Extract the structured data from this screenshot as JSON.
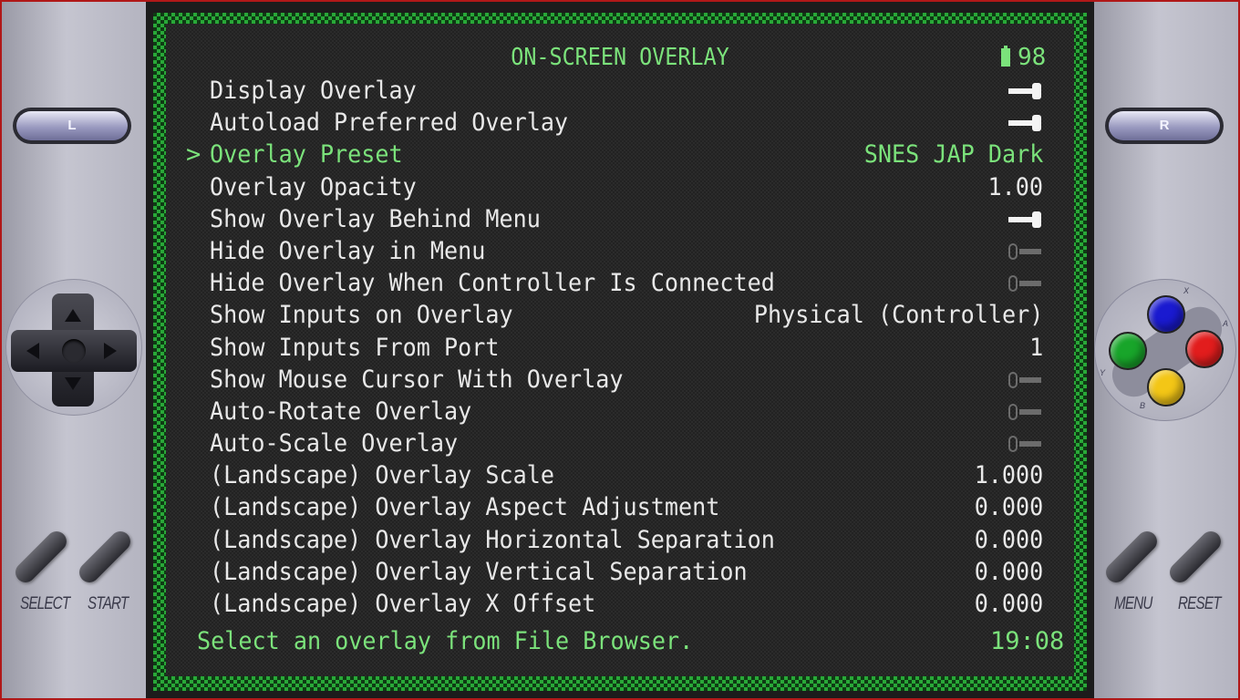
{
  "colors": {
    "accent": "#7be27b",
    "border_outer": "#b01818",
    "checker": "#29a838"
  },
  "controller": {
    "l_label": "L",
    "r_label": "R",
    "select_label": "SELECT",
    "start_label": "START",
    "menu_label": "MENU",
    "reset_label": "RESET",
    "face": {
      "x": "X",
      "a": "A",
      "y": "Y",
      "b": "B"
    }
  },
  "header": {
    "title": "ON-SCREEN OVERLAY",
    "battery": "98"
  },
  "menu": {
    "items": [
      {
        "label": "Display Overlay",
        "type": "toggle",
        "state": "on"
      },
      {
        "label": "Autoload Preferred Overlay",
        "type": "toggle",
        "state": "on"
      },
      {
        "label": "Overlay Preset",
        "value": "SNES JAP Dark",
        "selected": true
      },
      {
        "label": "Overlay Opacity",
        "value": "1.00"
      },
      {
        "label": "Show Overlay Behind Menu",
        "type": "toggle",
        "state": "on"
      },
      {
        "label": "Hide Overlay in Menu",
        "type": "toggle",
        "state": "off"
      },
      {
        "label": "Hide Overlay When Controller Is Connected",
        "type": "toggle",
        "state": "off"
      },
      {
        "label": "Show Inputs on Overlay",
        "value": "Physical (Controller)"
      },
      {
        "label": "Show Inputs From Port",
        "value": "1"
      },
      {
        "label": "Show Mouse Cursor With Overlay",
        "type": "toggle",
        "state": "off"
      },
      {
        "label": "Auto-Rotate Overlay",
        "type": "toggle",
        "state": "off"
      },
      {
        "label": "Auto-Scale Overlay",
        "type": "toggle",
        "state": "off"
      },
      {
        "label": "(Landscape) Overlay Scale",
        "value": "1.000"
      },
      {
        "label": "(Landscape) Overlay Aspect Adjustment",
        "value": "0.000"
      },
      {
        "label": "(Landscape) Overlay Horizontal Separation",
        "value": "0.000"
      },
      {
        "label": "(Landscape) Overlay Vertical Separation",
        "value": "0.000"
      },
      {
        "label": "(Landscape) Overlay X Offset",
        "value": "0.000"
      }
    ]
  },
  "footer": {
    "hint": "Select an overlay from File Browser.",
    "clock": "19:08"
  },
  "cursor": ">"
}
